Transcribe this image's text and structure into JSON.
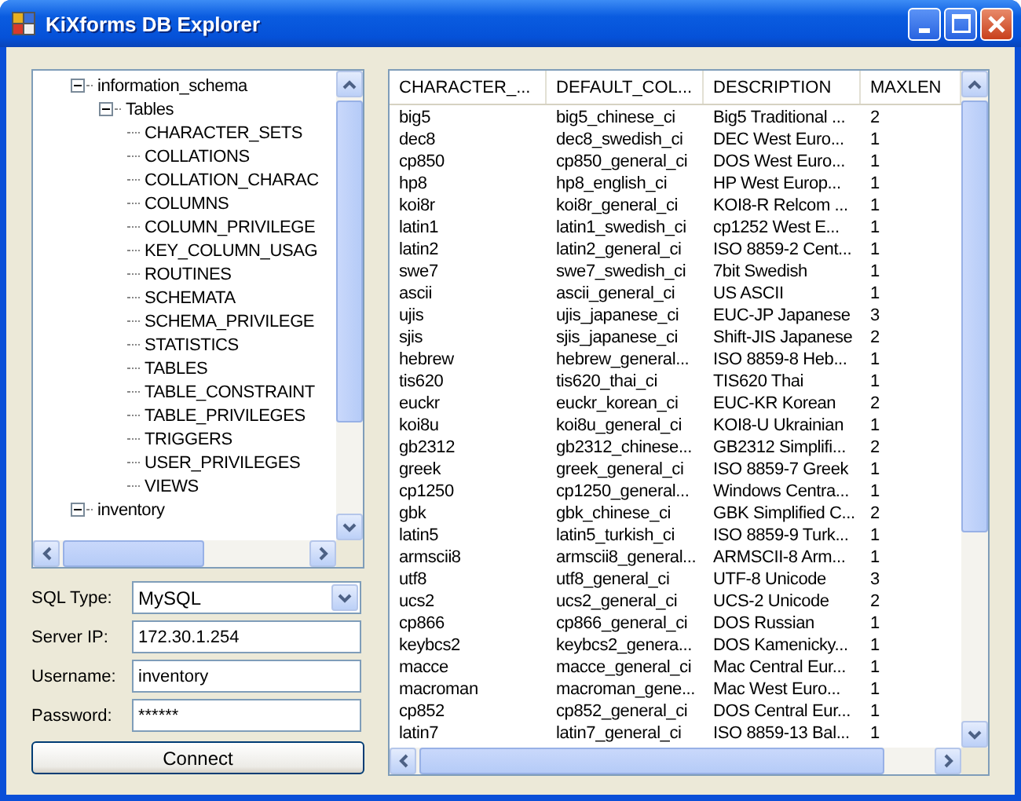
{
  "window": {
    "title": "KiXforms DB Explorer"
  },
  "tree": [
    {
      "label": "information_schema",
      "expanded": true,
      "children": [
        {
          "label": "Tables",
          "expanded": true,
          "children": [
            {
              "label": "CHARACTER_SETS"
            },
            {
              "label": "COLLATIONS"
            },
            {
              "label": "COLLATION_CHARAC"
            },
            {
              "label": "COLUMNS"
            },
            {
              "label": "COLUMN_PRIVILEGE"
            },
            {
              "label": "KEY_COLUMN_USAG"
            },
            {
              "label": "ROUTINES"
            },
            {
              "label": "SCHEMATA"
            },
            {
              "label": "SCHEMA_PRIVILEGE"
            },
            {
              "label": "STATISTICS"
            },
            {
              "label": "TABLES"
            },
            {
              "label": "TABLE_CONSTRAINT"
            },
            {
              "label": "TABLE_PRIVILEGES"
            },
            {
              "label": "TRIGGERS"
            },
            {
              "label": "USER_PRIVILEGES"
            },
            {
              "label": "VIEWS"
            }
          ]
        }
      ]
    },
    {
      "label": "inventory",
      "expanded": true
    }
  ],
  "form": [
    {
      "kind": "dropdown",
      "label": "SQL Type:",
      "value": "MySQL"
    },
    {
      "kind": "text",
      "label": "Server IP:",
      "value": "172.30.1.254"
    },
    {
      "kind": "text",
      "label": "Username:",
      "value": "inventory"
    },
    {
      "kind": "text",
      "label": "Password:",
      "value": "******"
    }
  ],
  "connect_button": "Connect",
  "table": {
    "columns": [
      "CHARACTER_...",
      "DEFAULT_COL...",
      "DESCRIPTION",
      "MAXLEN"
    ],
    "rows": [
      [
        "big5",
        "big5_chinese_ci",
        "Big5 Traditional ...",
        "2"
      ],
      [
        "dec8",
        "dec8_swedish_ci",
        "DEC West Euro...",
        "1"
      ],
      [
        "cp850",
        "cp850_general_ci",
        "DOS West Euro...",
        "1"
      ],
      [
        "hp8",
        "hp8_english_ci",
        "HP West Europ...",
        "1"
      ],
      [
        "koi8r",
        "koi8r_general_ci",
        "KOI8-R Relcom ...",
        "1"
      ],
      [
        "latin1",
        "latin1_swedish_ci",
        "cp1252 West E...",
        "1"
      ],
      [
        "latin2",
        "latin2_general_ci",
        "ISO 8859-2 Cent...",
        "1"
      ],
      [
        "swe7",
        "swe7_swedish_ci",
        "7bit Swedish",
        "1"
      ],
      [
        "ascii",
        "ascii_general_ci",
        "US ASCII",
        "1"
      ],
      [
        "ujis",
        "ujis_japanese_ci",
        "EUC-JP Japanese",
        "3"
      ],
      [
        "sjis",
        "sjis_japanese_ci",
        "Shift-JIS Japanese",
        "2"
      ],
      [
        "hebrew",
        "hebrew_general...",
        "ISO 8859-8 Heb...",
        "1"
      ],
      [
        "tis620",
        "tis620_thai_ci",
        "TIS620 Thai",
        "1"
      ],
      [
        "euckr",
        "euckr_korean_ci",
        "EUC-KR Korean",
        "2"
      ],
      [
        "koi8u",
        "koi8u_general_ci",
        "KOI8-U Ukrainian",
        "1"
      ],
      [
        "gb2312",
        "gb2312_chinese...",
        "GB2312 Simplifi...",
        "2"
      ],
      [
        "greek",
        "greek_general_ci",
        "ISO 8859-7 Greek",
        "1"
      ],
      [
        "cp1250",
        "cp1250_general...",
        "Windows Centra...",
        "1"
      ],
      [
        "gbk",
        "gbk_chinese_ci",
        "GBK Simplified C...",
        "2"
      ],
      [
        "latin5",
        "latin5_turkish_ci",
        "ISO 8859-9 Turk...",
        "1"
      ],
      [
        "armscii8",
        "armscii8_general...",
        "ARMSCII-8 Arm...",
        "1"
      ],
      [
        "utf8",
        "utf8_general_ci",
        "UTF-8 Unicode",
        "3"
      ],
      [
        "ucs2",
        "ucs2_general_ci",
        "UCS-2 Unicode",
        "2"
      ],
      [
        "cp866",
        "cp866_general_ci",
        "DOS Russian",
        "1"
      ],
      [
        "keybcs2",
        "keybcs2_genera...",
        "DOS Kamenicky...",
        "1"
      ],
      [
        "macce",
        "macce_general_ci",
        "Mac Central Eur...",
        "1"
      ],
      [
        "macroman",
        "macroman_gene...",
        "Mac West Euro...",
        "1"
      ],
      [
        "cp852",
        "cp852_general_ci",
        "DOS Central Eur...",
        "1"
      ],
      [
        "latin7",
        "latin7_general_ci",
        "ISO 8859-13 Bal...",
        "1"
      ]
    ]
  }
}
